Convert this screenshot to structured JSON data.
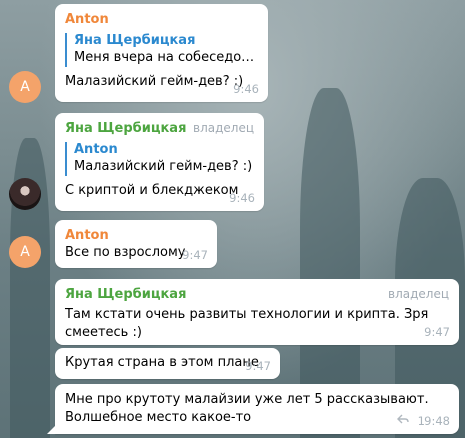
{
  "colors": {
    "anton": "#f0873a",
    "yana": "#4da540",
    "quote_bar": "#3a8dd0",
    "avatar_anton": "#f4a36a"
  },
  "messages": {
    "m1": {
      "sender": "Anton",
      "quote_name": "Яна Щербицкая",
      "quote_text": "Меня вчера на собеседован...",
      "text": "Малазийский гейм-дев? :)",
      "time": "9:46"
    },
    "m2": {
      "sender": "Яна Щербицкая",
      "badge": "владелец",
      "quote_name": "Anton",
      "quote_text": "Малазийский гейм-дев? :)",
      "text": "С криптой и блекджеком",
      "time": "9:46"
    },
    "m3": {
      "sender": "Anton",
      "text": "Все по взрослому",
      "time": "9:47"
    },
    "m4": {
      "sender": "Яна Щербицкая",
      "badge": "владелец",
      "text_line1": "Там кстати очень развиты технологии и крипта. Зря",
      "text_line2": "смеетесь :)",
      "time": "9:47"
    },
    "m5": {
      "text": "Крутая страна в этом плане",
      "time": "9:47"
    },
    "m6": {
      "text_line1": "Мне про крутоту малайзии уже лет 5 рассказывают.",
      "text_line2": "Волшебное место какое-то",
      "reply_count": "1",
      "time": "9:48"
    }
  },
  "avatars": {
    "anton_letter": "A"
  },
  "icons": {
    "reply": "reply-icon",
    "yana_photo": "user-photo-avatar"
  }
}
